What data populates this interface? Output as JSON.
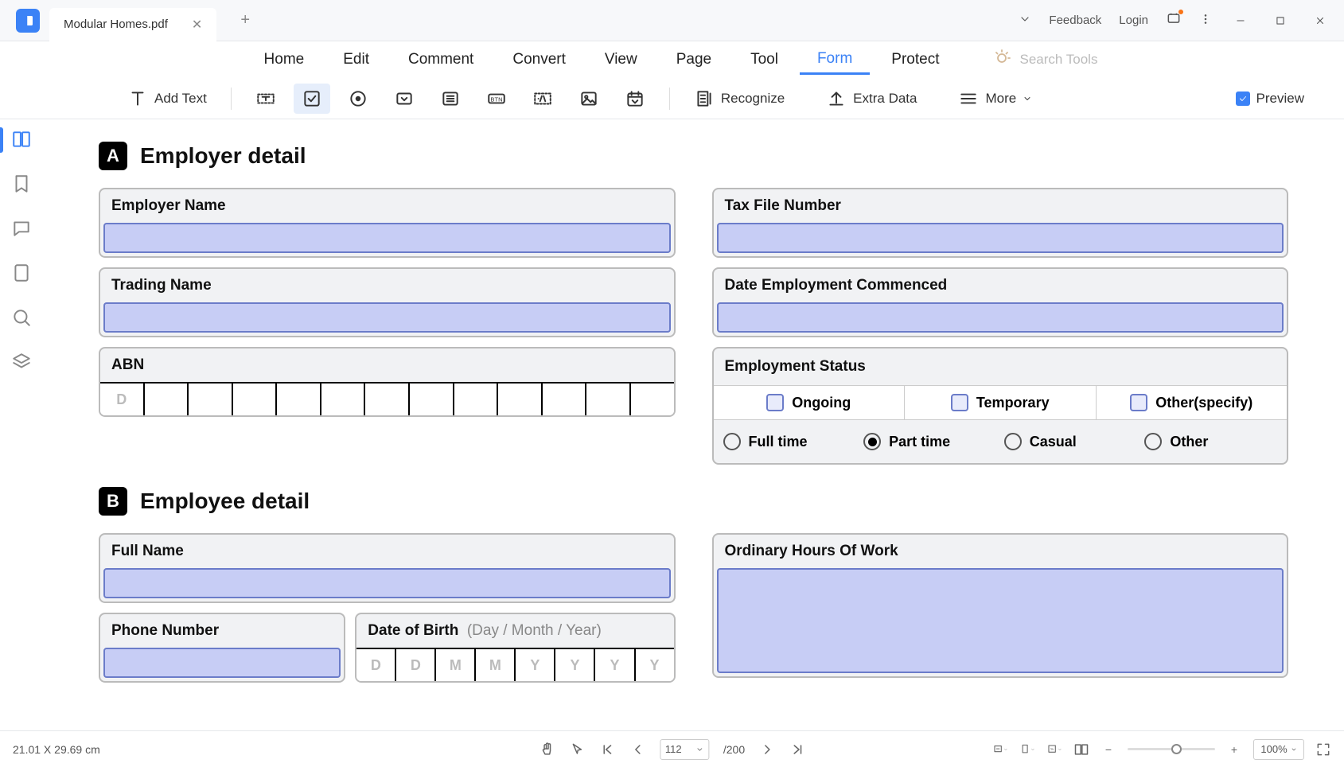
{
  "titlebar": {
    "tab_name": "Modular Homes.pdf",
    "feedback": "Feedback",
    "login": "Login"
  },
  "menubar": {
    "items": [
      "Home",
      "Edit",
      "Comment",
      "Convert",
      "View",
      "Page",
      "Tool",
      "Form",
      "Protect"
    ],
    "active_index": 7,
    "search_placeholder": "Search Tools"
  },
  "toolbar": {
    "add_text": "Add Text",
    "recognize": "Recognize",
    "extra_data": "Extra Data",
    "more": "More",
    "preview": "Preview"
  },
  "form": {
    "section_a": {
      "badge": "A",
      "title": "Employer detail"
    },
    "section_b": {
      "badge": "B",
      "title": "Employee detail"
    },
    "employer_name": "Employer Name",
    "trading_name": "Trading Name",
    "abn": "ABN",
    "abn_placeholder": "D",
    "tax_file": "Tax File Number",
    "date_commenced": "Date Employment Commenced",
    "emp_status": "Employment Status",
    "status_opts": [
      "Ongoing",
      "Temporary",
      "Other(specify)"
    ],
    "time_opts": [
      "Full time",
      "Part time",
      "Casual",
      "Other"
    ],
    "time_selected_index": 1,
    "full_name": "Full Name",
    "phone": "Phone Number",
    "dob": "Date of Birth",
    "dob_hint": "(Day / Month / Year)",
    "dob_boxes": [
      "D",
      "D",
      "M",
      "M",
      "Y",
      "Y",
      "Y",
      "Y"
    ],
    "hours": "Ordinary Hours Of Work"
  },
  "statusbar": {
    "dims": "21.01 X 29.69 cm",
    "page_current": "112",
    "page_total": "/200",
    "zoom": "100%"
  }
}
